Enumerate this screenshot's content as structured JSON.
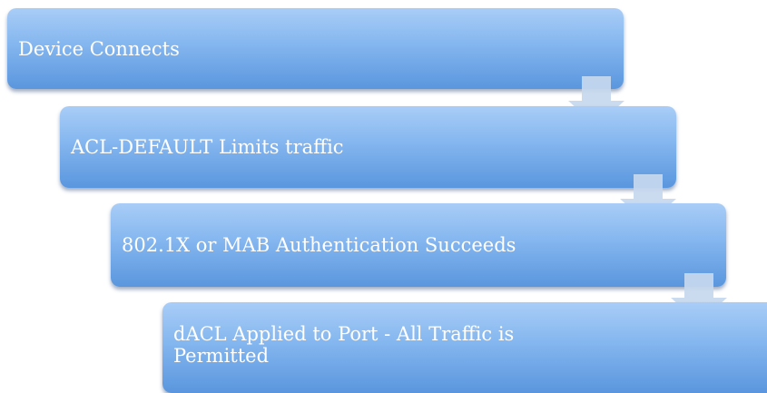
{
  "steps": [
    {
      "label": "Device Connects"
    },
    {
      "label": "ACL-DEFAULT Limits traffic"
    },
    {
      "label": "802.1X or MAB Authentication Succeeds"
    },
    {
      "label": "dACL Applied to Port - All Traffic is\nPermitted"
    }
  ],
  "colors": {
    "box_top": "#a9cdf7",
    "box_bottom": "#5a96de",
    "arrow": "#c7d8ee",
    "text": "#ffffff"
  }
}
